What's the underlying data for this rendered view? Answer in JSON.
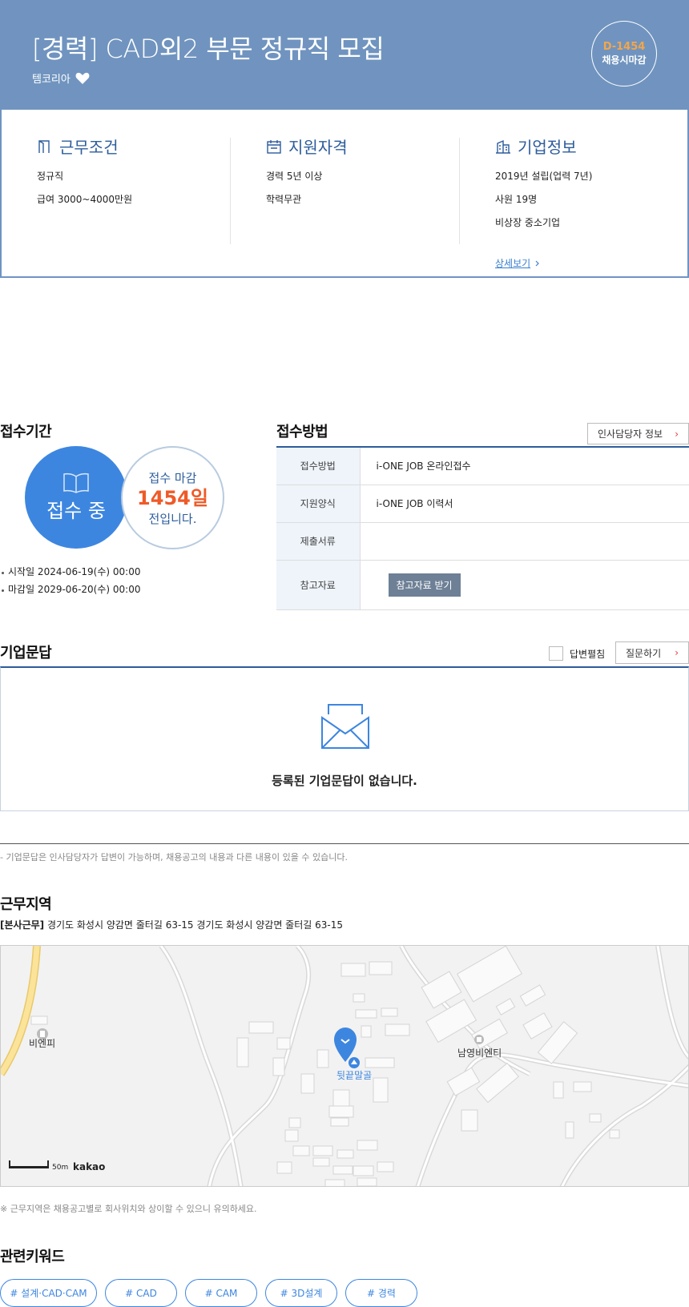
{
  "header": {
    "title": "[경력] CAD외2 부문 정규직 모집",
    "company": "템코리아",
    "dday": "D-1454",
    "deadline_type": "채용시마감"
  },
  "summary": {
    "work": {
      "title": "근무조건",
      "items": [
        "정규직",
        "급여 3000~4000만원"
      ]
    },
    "qual": {
      "title": "지원자격",
      "items": [
        "경력 5년 이상",
        "학력무관"
      ]
    },
    "company": {
      "title": "기업정보",
      "items": [
        "2019년 설립(업력 7년)",
        "사원 19명",
        "비상장 중소기업"
      ],
      "more": "상세보기"
    }
  },
  "period": {
    "title": "접수기간",
    "status": "접수 중",
    "remain_l1": "접수 마감",
    "remain_days": "1454일",
    "remain_l3": "전입니다.",
    "start": "시작일 2024-06-19(수) 00:00",
    "end": "마감일 2029-06-20(수) 00:00"
  },
  "method": {
    "title": "접수방법",
    "hr_button": "인사담당자 정보",
    "rows": [
      {
        "k": "접수방법",
        "v": "i-ONE JOB 온라인접수"
      },
      {
        "k": "지원양식",
        "v": "i-ONE JOB 이력서"
      },
      {
        "k": "제출서류",
        "v": ""
      },
      {
        "k": "참고자료",
        "v": ""
      }
    ],
    "ref_button": "참고자료 받기"
  },
  "qa": {
    "title": "기업문답",
    "toggle": "답변펼침",
    "ask_button": "질문하기",
    "empty": "등록된 기업문답이 없습니다.",
    "note": "- 기업문답은 인사담당자가 답변이 가능하며, 채용공고의 내용과 다른 내용이 있을 수 있습니다."
  },
  "location": {
    "title": "근무지역",
    "tag": "[본사근무]",
    "address": " 경기도 화성시 양감면 줄터길 63-15 경기도 화성시 양감면 줄터길 63-15",
    "map_labels": [
      "비엔피",
      "남영비엔티",
      "뒷끝말골"
    ],
    "scale": "50m",
    "brand": "kakao",
    "note": "※ 근무지역은 채용공고별로 회사위치와 상이할 수 있으니 유의하세요."
  },
  "keywords": {
    "title": "관련키워드",
    "items": [
      "# 설계·CAD·CAM",
      "# CAD",
      "# CAM",
      "# 3D설계",
      "# 경력"
    ]
  },
  "colors": {
    "accent": "#3d86e0",
    "hero": "#7094bf",
    "navy": "#2d5c9c",
    "orange": "#ef5a28"
  }
}
